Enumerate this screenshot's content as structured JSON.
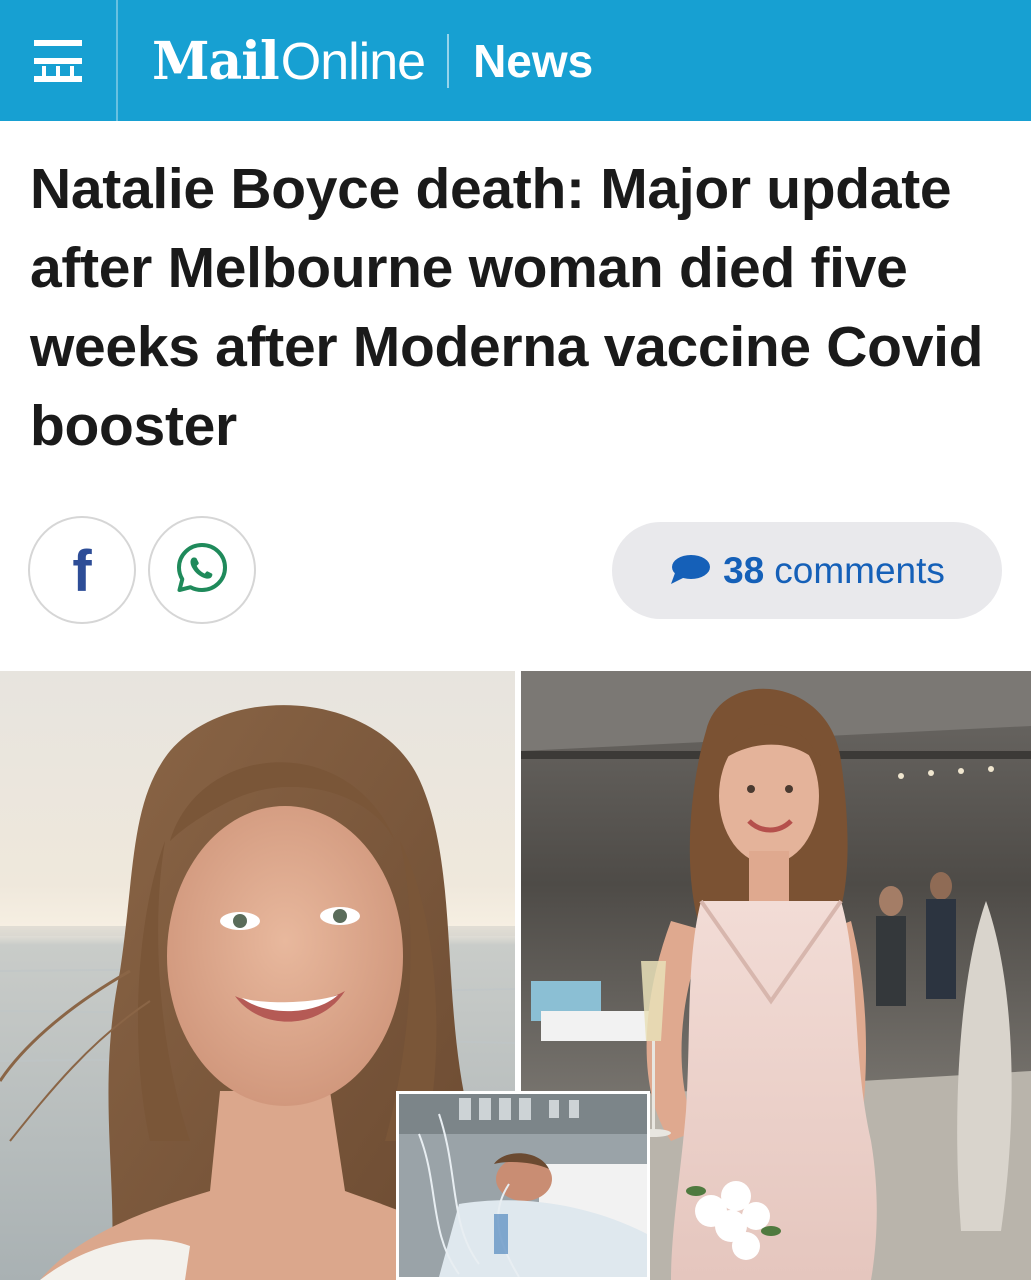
{
  "header": {
    "brand_mail": "Mail",
    "brand_online": "Online",
    "section": "News",
    "colors": {
      "bar": "#17a0d2",
      "text": "#ffffff"
    },
    "menu_icon": "hamburger-menu-icon"
  },
  "article": {
    "headline": "Natalie Boyce death: Major update after Melbourne woman died five weeks after Moderna vaccine Covid booster"
  },
  "share": {
    "facebook_label": "f",
    "facebook_icon": "facebook-icon",
    "whatsapp_icon": "whatsapp-icon",
    "comments_icon": "speech-bubble-icon",
    "comments_count": "38",
    "comments_label": "comments",
    "colors": {
      "facebook": "#2d4d97",
      "whatsapp": "#1f8a5b",
      "comments": "#1560b8"
    }
  },
  "images": {
    "left": "photo-woman-beach",
    "right": "photo-woman-pink-dress",
    "inset": "photo-hospital-bed"
  }
}
